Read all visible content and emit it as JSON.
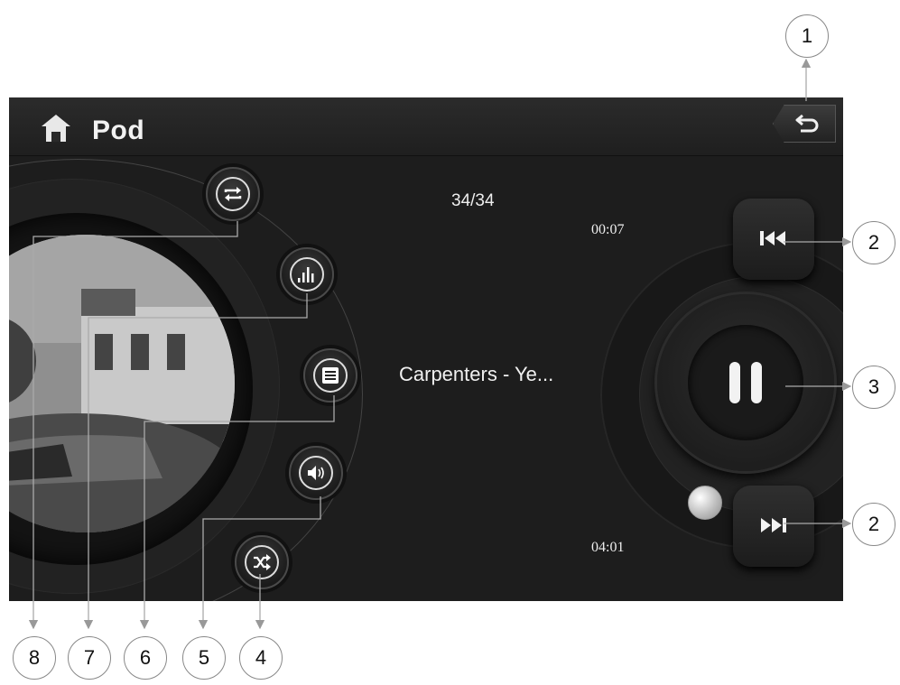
{
  "header": {
    "title": "Pod",
    "home_icon": "home-icon",
    "back_icon": "back-arrow-icon"
  },
  "player": {
    "track_counter": "34/34",
    "elapsed_time": "00:07",
    "total_time": "04:01",
    "track_title": "Carpenters - Ye...",
    "state": "playing"
  },
  "side_buttons": [
    {
      "icon": "repeat-icon"
    },
    {
      "icon": "equalizer-icon"
    },
    {
      "icon": "playlist-icon"
    },
    {
      "icon": "volume-icon"
    },
    {
      "icon": "shuffle-icon"
    }
  ],
  "controls": {
    "prev_icon": "previous-track-icon",
    "pause_icon": "pause-icon",
    "next_icon": "next-track-icon"
  },
  "callouts": [
    "1",
    "2",
    "3",
    "2",
    "8",
    "7",
    "6",
    "5",
    "4"
  ]
}
